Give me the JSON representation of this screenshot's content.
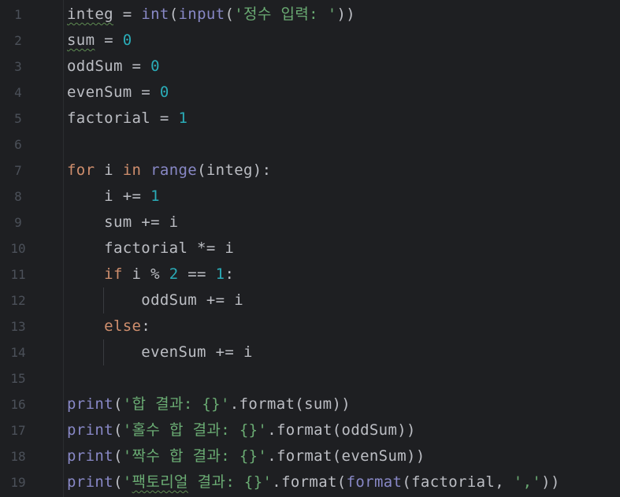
{
  "editor": {
    "line_numbers": [
      "1",
      "2",
      "3",
      "4",
      "5",
      "6",
      "7",
      "8",
      "9",
      "10",
      "11",
      "12",
      "13",
      "14",
      "15",
      "16",
      "17",
      "18",
      "19"
    ],
    "lines": [
      [
        {
          "t": "integ",
          "c": "wavy"
        },
        {
          "t": " = "
        },
        {
          "t": "int",
          "c": "bi"
        },
        {
          "t": "("
        },
        {
          "t": "input",
          "c": "bi"
        },
        {
          "t": "("
        },
        {
          "t": "'정수 입력: '",
          "c": "str"
        },
        {
          "t": "))"
        }
      ],
      [
        {
          "t": "sum",
          "c": "wavy"
        },
        {
          "t": " = "
        },
        {
          "t": "0",
          "c": "num"
        }
      ],
      [
        {
          "t": "oddSum = "
        },
        {
          "t": "0",
          "c": "num"
        }
      ],
      [
        {
          "t": "evenSum = "
        },
        {
          "t": "0",
          "c": "num"
        }
      ],
      [
        {
          "t": "factorial = "
        },
        {
          "t": "1",
          "c": "num"
        }
      ],
      [],
      [
        {
          "t": "for",
          "c": "kw"
        },
        {
          "t": " i "
        },
        {
          "t": "in",
          "c": "kw"
        },
        {
          "t": " "
        },
        {
          "t": "range",
          "c": "bi"
        },
        {
          "t": "(integ):"
        }
      ],
      [
        {
          "t": "    i += "
        },
        {
          "t": "1",
          "c": "num"
        }
      ],
      [
        {
          "t": "    sum += i"
        }
      ],
      [
        {
          "t": "    factorial *= i"
        }
      ],
      [
        {
          "t": "    "
        },
        {
          "t": "if",
          "c": "kw"
        },
        {
          "t": " i % "
        },
        {
          "t": "2",
          "c": "num"
        },
        {
          "t": " == "
        },
        {
          "t": "1",
          "c": "num"
        },
        {
          "t": ":"
        }
      ],
      [
        {
          "t": "        oddSum += i"
        }
      ],
      [
        {
          "t": "    "
        },
        {
          "t": "else",
          "c": "kw"
        },
        {
          "t": ":"
        }
      ],
      [
        {
          "t": "        evenSum += i"
        }
      ],
      [],
      [
        {
          "t": "print",
          "c": "bi"
        },
        {
          "t": "("
        },
        {
          "t": "'합 결과: {}'",
          "c": "str"
        },
        {
          "t": ".format(sum))"
        }
      ],
      [
        {
          "t": "print",
          "c": "bi"
        },
        {
          "t": "("
        },
        {
          "t": "'홀수 합 결과: {}'",
          "c": "str"
        },
        {
          "t": ".format(oddSum))"
        }
      ],
      [
        {
          "t": "print",
          "c": "bi"
        },
        {
          "t": "("
        },
        {
          "t": "'짝수 합 결과: {}'",
          "c": "str"
        },
        {
          "t": ".format(evenSum))"
        }
      ],
      [
        {
          "t": "print",
          "c": "bi"
        },
        {
          "t": "("
        },
        {
          "t": "'",
          "c": "str"
        },
        {
          "t": "팩토리얼",
          "c": "str wavy"
        },
        {
          "t": " 결과: {}'",
          "c": "str"
        },
        {
          "t": ".format("
        },
        {
          "t": "format",
          "c": "bi"
        },
        {
          "t": "(factorial, "
        },
        {
          "t": "','",
          "c": "str"
        },
        {
          "t": "))"
        }
      ]
    ]
  },
  "colors": {
    "background": "#1e1f22",
    "line_number": "#4b5059",
    "text": "#bcbec4",
    "keyword": "#cf8e6d",
    "builtin": "#8888c6",
    "number": "#2aacb8",
    "string": "#6aab73"
  }
}
